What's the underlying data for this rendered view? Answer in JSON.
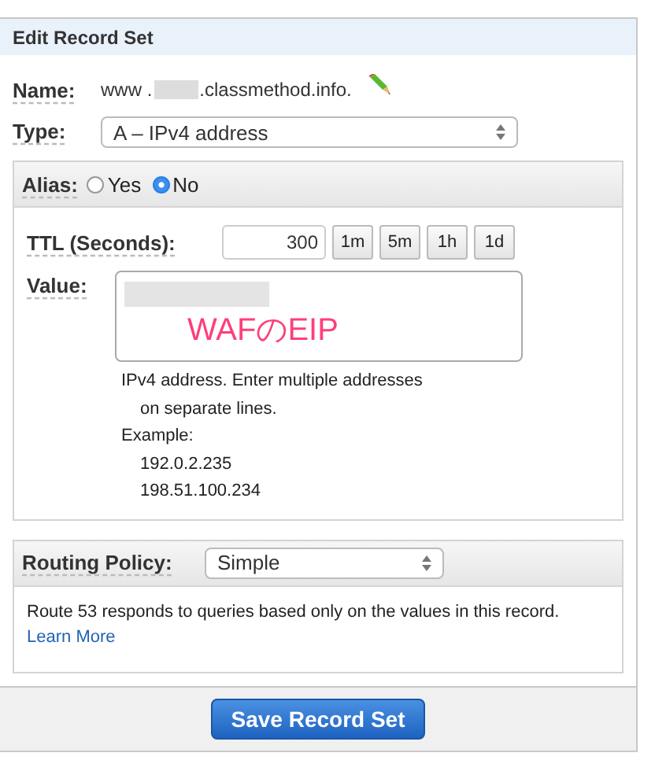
{
  "panel": {
    "title": "Edit Record Set"
  },
  "name": {
    "label": "Name:",
    "prefix": "www .",
    "suffix": ".classmethod.info.",
    "redacted": true
  },
  "type": {
    "label": "Type:",
    "value": "A – IPv4 address"
  },
  "alias": {
    "label": "Alias:",
    "options": [
      {
        "label": "Yes",
        "selected": false
      },
      {
        "label": "No",
        "selected": true
      }
    ]
  },
  "ttl": {
    "label": "TTL (Seconds):",
    "value": "300",
    "presets": [
      "1m",
      "5m",
      "1h",
      "1d"
    ]
  },
  "value": {
    "label": "Value:",
    "redacted": true,
    "annotation": "WAFのEIP",
    "help": [
      "IPv4 address. Enter multiple addresses",
      "on separate lines.",
      "Example:",
      "192.0.2.235",
      "198.51.100.234"
    ]
  },
  "routing": {
    "label": "Routing Policy:",
    "value": "Simple",
    "description": "Route 53 responds to queries based only on the values in this record.",
    "link": "Learn More"
  },
  "save_button": "Save Record Set"
}
